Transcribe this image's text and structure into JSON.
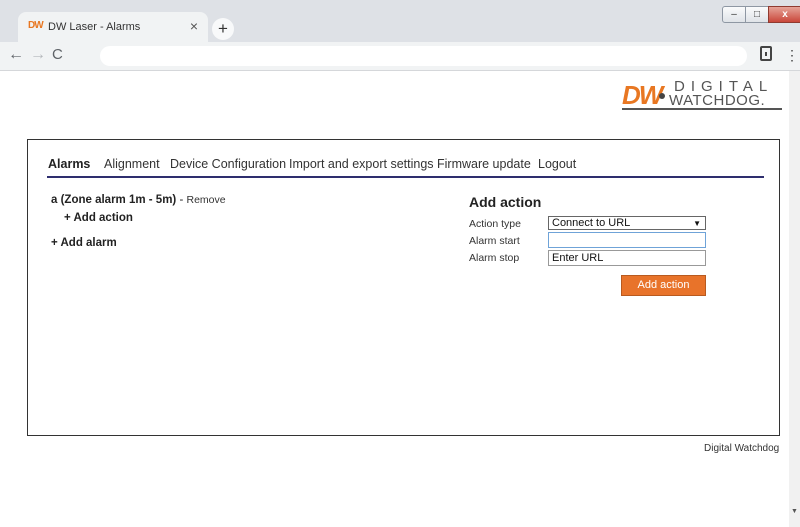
{
  "browser": {
    "tab_favicon": "DW",
    "tab_title": "DW Laser - Alarms",
    "tab_close": "×",
    "new_tab": "+",
    "win_min": "‒",
    "win_max": "□",
    "win_close": "x",
    "back": "←",
    "forward": "→",
    "reload": "C",
    "menu": "⋮",
    "url": ""
  },
  "logo": {
    "mark": "DW",
    "line1": "DIGITAL",
    "line2": "WATCHDOG."
  },
  "nav": {
    "items": [
      "Alarms",
      "Alignment",
      "Device Configuration",
      "Import and export settings",
      "Firmware update",
      "Logout"
    ],
    "active": "Alarms"
  },
  "alarm": {
    "name": "a (Zone alarm 1m - 5m)",
    "separator": " - ",
    "remove": "Remove",
    "add_action": "+ Add action"
  },
  "add_alarm": "+ Add alarm",
  "form": {
    "title": "Add action",
    "labels": {
      "type": "Action type",
      "start": "Alarm start",
      "stop": "Alarm stop"
    },
    "action_type": "Connect to URL",
    "alarm_start_value": "",
    "alarm_stop_placeholder": "Enter URL",
    "button": "Add action"
  },
  "footer": "Digital Watchdog",
  "colors": {
    "accent": "#e8732a",
    "nav_underline": "#2e2e6e"
  }
}
